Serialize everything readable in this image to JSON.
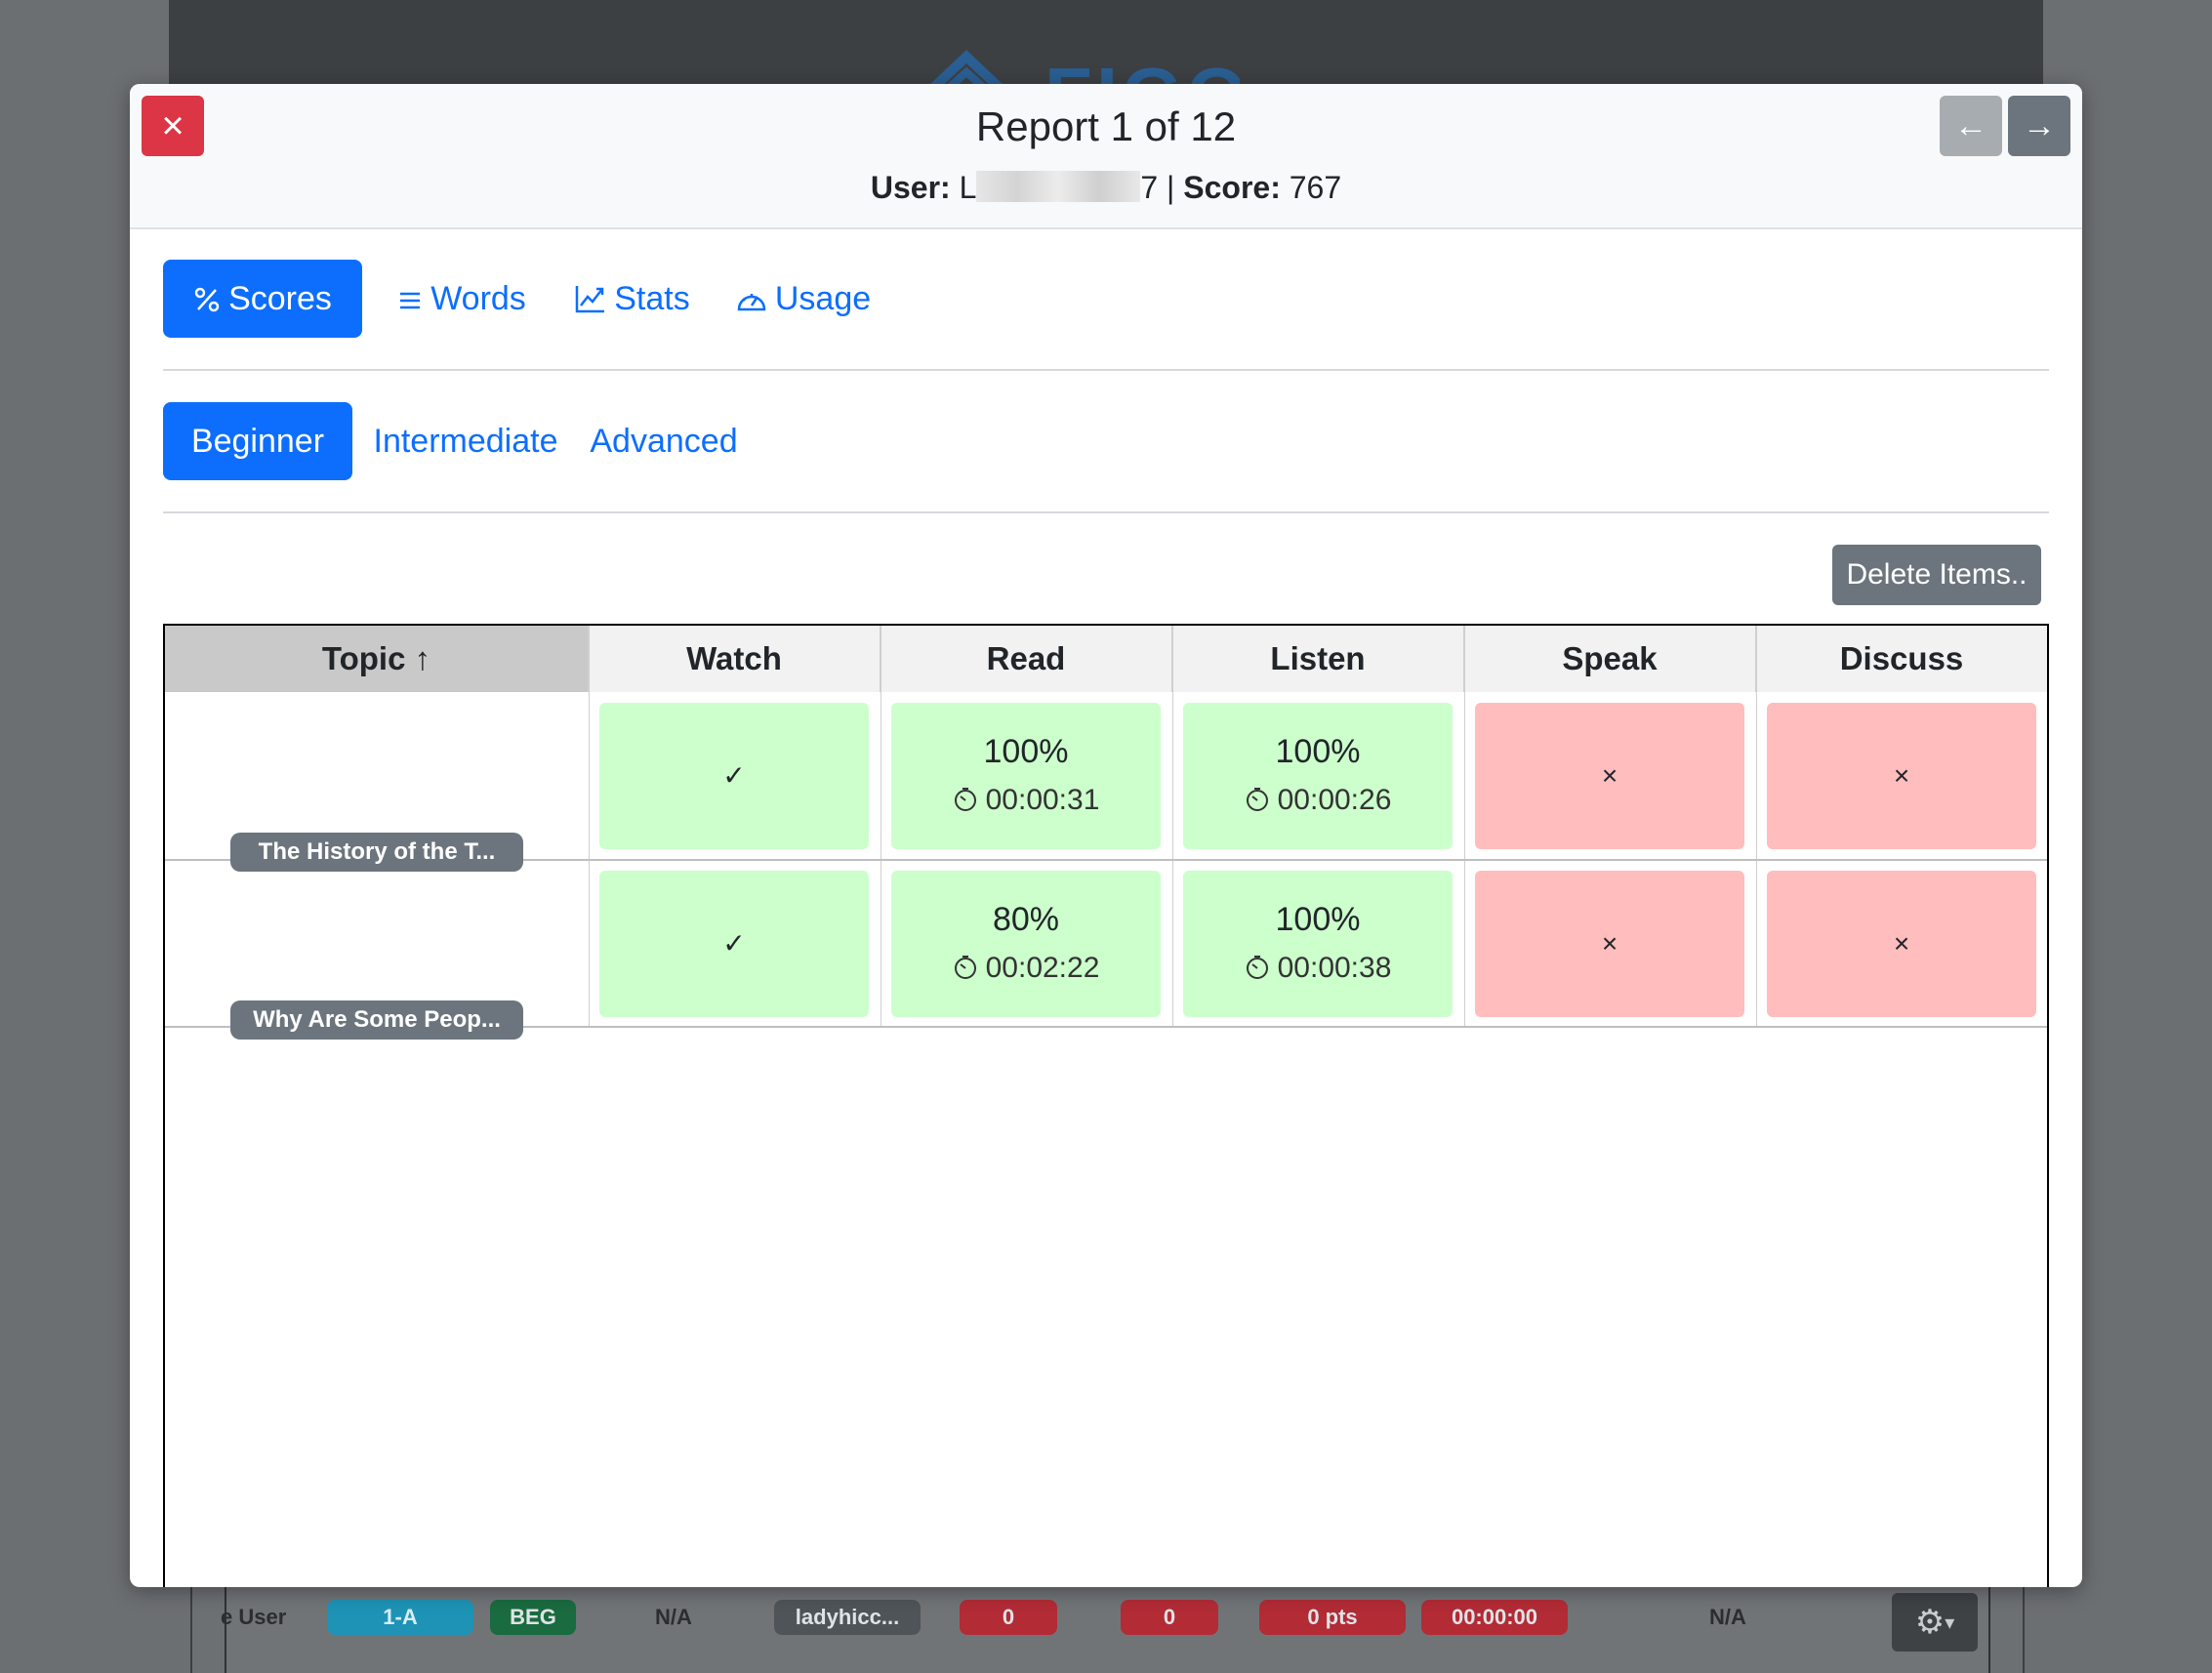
{
  "background": {
    "logo_text": "FIGO",
    "row": {
      "user": "e User",
      "class_badge": "1-A",
      "level_badge": "BEG",
      "na1": "N/A",
      "username_badge": "ladyhicc...",
      "count1": "0",
      "count2": "0",
      "points": "0 pts",
      "time": "00:00:00",
      "na2": "N/A"
    },
    "colors": {
      "class": "#1e93b5",
      "level": "#1a6b3f",
      "red": "#b22b35",
      "gray": "#4f5459"
    }
  },
  "modal": {
    "title": "Report 1 of 12",
    "user_label": "User:",
    "user_value_prefix": "L",
    "user_value_suffix": "7",
    "separator": "|",
    "score_label": "Score:",
    "score_value": "767",
    "close_icon": "×",
    "prev_icon": "←",
    "next_icon": "→"
  },
  "tabs": [
    {
      "label": "Scores",
      "icon": "percent-icon",
      "active": true
    },
    {
      "label": "Words",
      "icon": "list-icon",
      "active": false
    },
    {
      "label": "Stats",
      "icon": "graph-icon",
      "active": false
    },
    {
      "label": "Usage",
      "icon": "speedometer-icon",
      "active": false
    }
  ],
  "levels": [
    {
      "label": "Beginner",
      "active": true
    },
    {
      "label": "Intermediate",
      "active": false
    },
    {
      "label": "Advanced",
      "active": false
    }
  ],
  "delete_label": "Delete Items..",
  "table": {
    "headers": {
      "topic": "Topic ↑",
      "watch": "Watch",
      "read": "Read",
      "listen": "Listen",
      "speak": "Speak",
      "discuss": "Discuss"
    },
    "rows": [
      {
        "topic": "The History of the T...",
        "watch": "✓",
        "read_pct": "100%",
        "read_time": "00:00:31",
        "listen_pct": "100%",
        "listen_time": "00:00:26",
        "speak": "×",
        "discuss": "×"
      },
      {
        "topic": "Why Are Some Peop...",
        "watch": "✓",
        "read_pct": "80%",
        "read_time": "00:02:22",
        "listen_pct": "100%",
        "listen_time": "00:00:38",
        "speak": "×",
        "discuss": "×"
      }
    ]
  },
  "colors": {
    "primary": "#0d6efd",
    "success_cell": "#ccffcc",
    "danger_cell": "#ffbdbd",
    "close": "#dc3545",
    "secondary": "#6c757d"
  }
}
